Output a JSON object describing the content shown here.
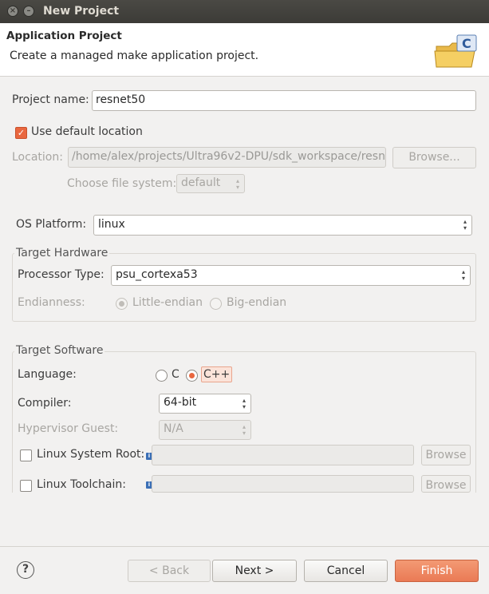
{
  "window": {
    "title": "New Project"
  },
  "header": {
    "title": "Application Project",
    "description": "Create a managed make application project."
  },
  "project": {
    "name_label": "Project name:",
    "name_value": "resnet50",
    "use_default_label": "Use default location",
    "use_default_checked": true,
    "location_label": "Location:",
    "location_value": "/home/alex/projects/Ultra96v2-DPU/sdk_workspace/resn",
    "browse_label": "Browse...",
    "filesystem_label": "Choose file system:",
    "filesystem_value": "default"
  },
  "os": {
    "label": "OS Platform:",
    "value": "linux"
  },
  "hardware": {
    "group_title": "Target Hardware",
    "processor_label": "Processor Type:",
    "processor_value": "psu_cortexa53",
    "endianness_label": "Endianness:",
    "little_label": "Little-endian",
    "big_label": "Big-endian",
    "selected": "Little-endian"
  },
  "software": {
    "group_title": "Target Software",
    "language_label": "Language:",
    "lang_c": "C",
    "lang_cpp": "C++",
    "selected_language": "C++",
    "compiler_label": "Compiler:",
    "compiler_value": "64-bit",
    "hypervisor_label": "Hypervisor Guest:",
    "hypervisor_value": "N/A",
    "sysroot_label": "Linux System Root:",
    "sysroot_browse": "Browse",
    "toolchain_label": "Linux Toolchain:",
    "toolchain_browse": "Browse",
    "info_glyph": "i"
  },
  "footer": {
    "help_glyph": "?",
    "back_label": "< Back",
    "next_label": "Next >",
    "cancel_label": "Cancel",
    "finish_label": "Finish"
  },
  "colors": {
    "accent": "#e9673f",
    "titlebar": "#3c3b37",
    "window_bg": "#f2f1f0"
  },
  "icons": {
    "close": "close-icon",
    "minimize": "minimize-icon",
    "wizard": "c-folder-icon",
    "help": "help-icon",
    "info": "info-icon"
  }
}
